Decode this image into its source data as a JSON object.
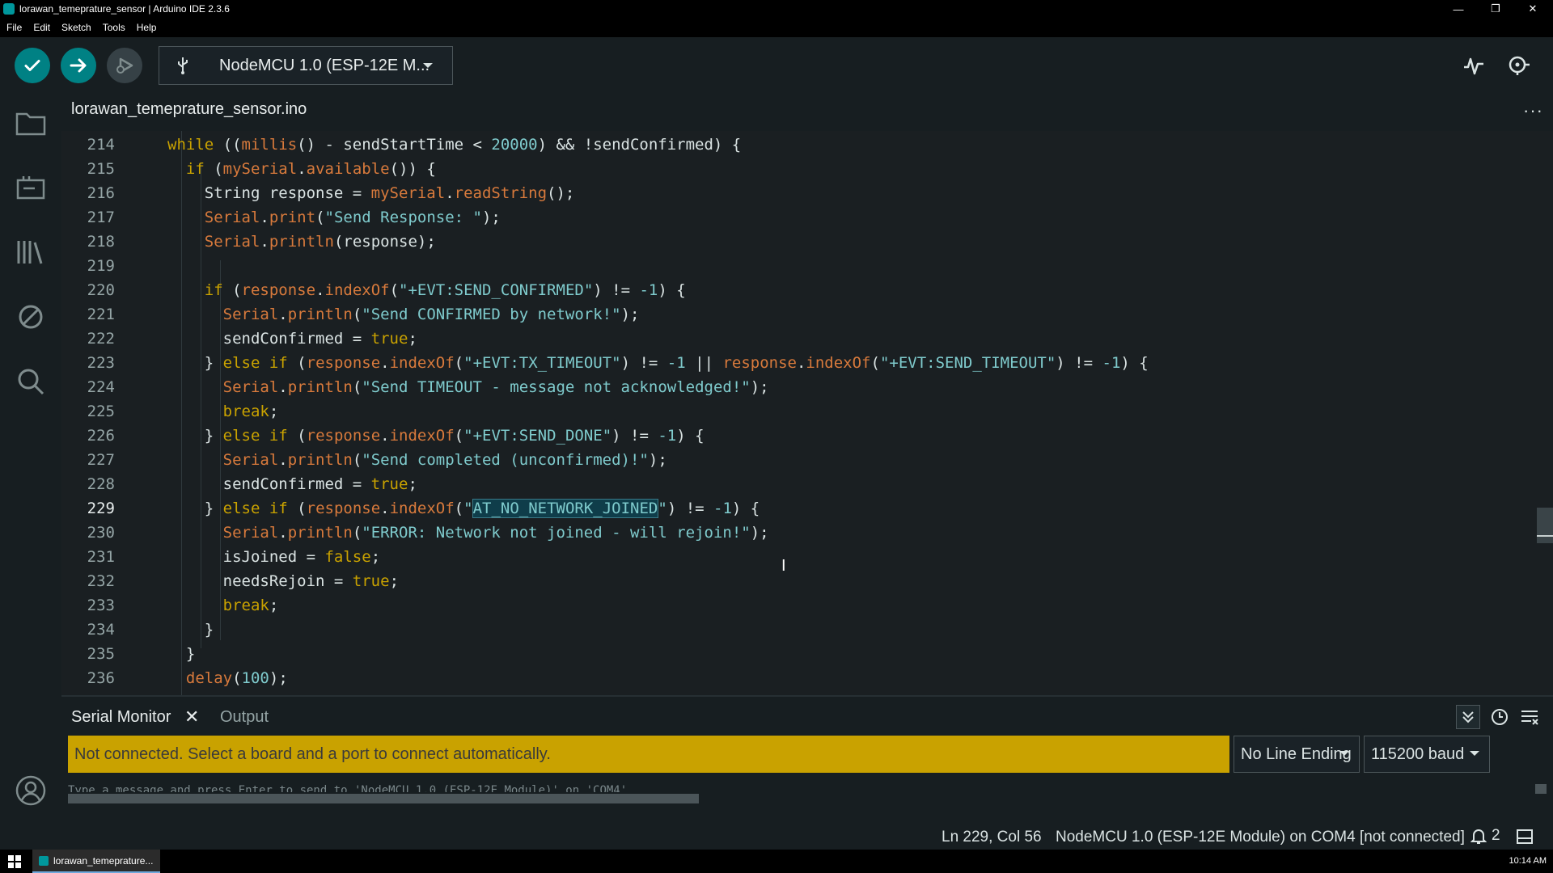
{
  "window": {
    "title": "lorawan_temeprature_sensor | Arduino IDE 2.3.6",
    "min_glyph": "—",
    "max_glyph": "❐",
    "close_glyph": "✕"
  },
  "menu": [
    "File",
    "Edit",
    "Sketch",
    "Tools",
    "Help"
  ],
  "toolbar": {
    "board_label": "NodeMCU 1.0 (ESP-12E M...",
    "icons": [
      "verify-icon",
      "upload-icon",
      "debug-icon",
      "usb-icon",
      "serial-plotter-icon",
      "serial-monitor-icon"
    ]
  },
  "sidebar": {
    "icons": [
      "folder-icon",
      "boards-manager-icon",
      "library-manager-icon",
      "debug-off-icon",
      "search-icon",
      "account-icon"
    ]
  },
  "editor": {
    "tab_label": "lorawan_temeprature_sensor.ino",
    "more_label": "···",
    "active_line": 229,
    "colors": {
      "keyword": "#c9a200",
      "function": "#d87a3c",
      "string": "#7fcbcd",
      "text": "#dae3e3"
    }
  },
  "code_lines": [
    {
      "n": "214",
      "indent": 1,
      "tokens": [
        [
          "kw",
          "while"
        ],
        [
          "t",
          " (("
        ],
        [
          "fn",
          "millis"
        ],
        [
          "t",
          "() - sendStartTime < "
        ],
        [
          "num",
          "20000"
        ],
        [
          "t",
          ") && !sendConfirmed) {"
        ]
      ]
    },
    {
      "n": "215",
      "indent": 2,
      "tokens": [
        [
          "kw",
          "if"
        ],
        [
          "t",
          " ("
        ],
        [
          "fn",
          "mySerial"
        ],
        [
          "t",
          "."
        ],
        [
          "fn",
          "available"
        ],
        [
          "t",
          "()) {"
        ]
      ]
    },
    {
      "n": "216",
      "indent": 3,
      "tokens": [
        [
          "t",
          "String response = "
        ],
        [
          "fn",
          "mySerial"
        ],
        [
          "t",
          "."
        ],
        [
          "fn",
          "readString"
        ],
        [
          "t",
          "();"
        ]
      ]
    },
    {
      "n": "217",
      "indent": 3,
      "tokens": [
        [
          "fn",
          "Serial"
        ],
        [
          "t",
          "."
        ],
        [
          "fn",
          "print"
        ],
        [
          "t",
          "("
        ],
        [
          "str",
          "\"Send Response: \""
        ],
        [
          "t",
          ");"
        ]
      ]
    },
    {
      "n": "218",
      "indent": 3,
      "tokens": [
        [
          "fn",
          "Serial"
        ],
        [
          "t",
          "."
        ],
        [
          "fn",
          "println"
        ],
        [
          "t",
          "(response);"
        ]
      ]
    },
    {
      "n": "219",
      "indent": 0,
      "tokens": []
    },
    {
      "n": "220",
      "indent": 3,
      "tokens": [
        [
          "kw",
          "if"
        ],
        [
          "t",
          " ("
        ],
        [
          "fn",
          "response"
        ],
        [
          "t",
          "."
        ],
        [
          "fn",
          "indexOf"
        ],
        [
          "t",
          "("
        ],
        [
          "str",
          "\"+EVT:SEND_CONFIRMED\""
        ],
        [
          "t",
          ") != "
        ],
        [
          "num",
          "-1"
        ],
        [
          "t",
          ") {"
        ]
      ]
    },
    {
      "n": "221",
      "indent": 4,
      "tokens": [
        [
          "fn",
          "Serial"
        ],
        [
          "t",
          "."
        ],
        [
          "fn",
          "println"
        ],
        [
          "t",
          "("
        ],
        [
          "str",
          "\"Send CONFIRMED by network!\""
        ],
        [
          "t",
          ");"
        ]
      ]
    },
    {
      "n": "222",
      "indent": 4,
      "tokens": [
        [
          "t",
          "sendConfirmed = "
        ],
        [
          "kw",
          "true"
        ],
        [
          "t",
          ";"
        ]
      ]
    },
    {
      "n": "223",
      "indent": 3,
      "tokens": [
        [
          "t",
          "} "
        ],
        [
          "kw",
          "else if"
        ],
        [
          "t",
          " ("
        ],
        [
          "fn",
          "response"
        ],
        [
          "t",
          "."
        ],
        [
          "fn",
          "indexOf"
        ],
        [
          "t",
          "("
        ],
        [
          "str",
          "\"+EVT:TX_TIMEOUT\""
        ],
        [
          "t",
          ") != "
        ],
        [
          "num",
          "-1"
        ],
        [
          "t",
          " || "
        ],
        [
          "fn",
          "response"
        ],
        [
          "t",
          "."
        ],
        [
          "fn",
          "indexOf"
        ],
        [
          "t",
          "("
        ],
        [
          "str",
          "\"+EVT:SEND_TIMEOUT\""
        ],
        [
          "t",
          ") != "
        ],
        [
          "num",
          "-1"
        ],
        [
          "t",
          ") {"
        ]
      ]
    },
    {
      "n": "224",
      "indent": 4,
      "tokens": [
        [
          "fn",
          "Serial"
        ],
        [
          "t",
          "."
        ],
        [
          "fn",
          "println"
        ],
        [
          "t",
          "("
        ],
        [
          "str",
          "\"Send TIMEOUT - message not acknowledged!\""
        ],
        [
          "t",
          ");"
        ]
      ]
    },
    {
      "n": "225",
      "indent": 4,
      "tokens": [
        [
          "kw",
          "break"
        ],
        [
          "t",
          ";"
        ]
      ]
    },
    {
      "n": "226",
      "indent": 3,
      "tokens": [
        [
          "t",
          "} "
        ],
        [
          "kw",
          "else if"
        ],
        [
          "t",
          " ("
        ],
        [
          "fn",
          "response"
        ],
        [
          "t",
          "."
        ],
        [
          "fn",
          "indexOf"
        ],
        [
          "t",
          "("
        ],
        [
          "str",
          "\"+EVT:SEND_DONE\""
        ],
        [
          "t",
          ") != "
        ],
        [
          "num",
          "-1"
        ],
        [
          "t",
          ") {"
        ]
      ]
    },
    {
      "n": "227",
      "indent": 4,
      "tokens": [
        [
          "fn",
          "Serial"
        ],
        [
          "t",
          "."
        ],
        [
          "fn",
          "println"
        ],
        [
          "t",
          "("
        ],
        [
          "str",
          "\"Send completed (unconfirmed)!\""
        ],
        [
          "t",
          ");"
        ]
      ]
    },
    {
      "n": "228",
      "indent": 4,
      "tokens": [
        [
          "t",
          "sendConfirmed = "
        ],
        [
          "kw",
          "true"
        ],
        [
          "t",
          ";"
        ]
      ]
    },
    {
      "n": "229",
      "indent": 3,
      "tokens": [
        [
          "t",
          "} "
        ],
        [
          "kw",
          "else if"
        ],
        [
          "t",
          " ("
        ],
        [
          "fn",
          "response"
        ],
        [
          "t",
          "."
        ],
        [
          "fn",
          "indexOf"
        ],
        [
          "t",
          "("
        ],
        [
          "str",
          "\""
        ],
        [
          "hl",
          "AT_NO_NETWORK_JOINED"
        ],
        [
          "str",
          "\""
        ],
        [
          "t",
          ") != "
        ],
        [
          "num",
          "-1"
        ],
        [
          "t",
          ") {"
        ]
      ]
    },
    {
      "n": "230",
      "indent": 4,
      "tokens": [
        [
          "fn",
          "Serial"
        ],
        [
          "t",
          "."
        ],
        [
          "fn",
          "println"
        ],
        [
          "t",
          "("
        ],
        [
          "str",
          "\"ERROR: Network not joined - will rejoin!\""
        ],
        [
          "t",
          ");"
        ]
      ]
    },
    {
      "n": "231",
      "indent": 4,
      "tokens": [
        [
          "t",
          "isJoined = "
        ],
        [
          "kw",
          "false"
        ],
        [
          "t",
          ";"
        ]
      ]
    },
    {
      "n": "232",
      "indent": 4,
      "tokens": [
        [
          "t",
          "needsRejoin = "
        ],
        [
          "kw",
          "true"
        ],
        [
          "t",
          ";"
        ]
      ]
    },
    {
      "n": "233",
      "indent": 4,
      "tokens": [
        [
          "kw",
          "break"
        ],
        [
          "t",
          ";"
        ]
      ]
    },
    {
      "n": "234",
      "indent": 3,
      "tokens": [
        [
          "t",
          "}"
        ]
      ]
    },
    {
      "n": "235",
      "indent": 2,
      "tokens": [
        [
          "t",
          "}"
        ]
      ]
    },
    {
      "n": "236",
      "indent": 2,
      "tokens": [
        [
          "fn",
          "delay"
        ],
        [
          "t",
          "("
        ],
        [
          "num",
          "100"
        ],
        [
          "t",
          ");"
        ]
      ]
    }
  ],
  "panel": {
    "serial_tab": "Serial Monitor",
    "close_glyph": "✕",
    "output_tab": "Output",
    "banner_text": "Not connected. Select a board and a port to connect automatically.",
    "banner_color": "#c9a200",
    "line_ending": "No Line Ending",
    "baud": "115200 baud",
    "monitor_text": "Type a message and press Enter to send to 'NodeMCU 1.0 (ESP-12E Module)' on 'COM4'",
    "icons": [
      "autoscroll-icon",
      "timestamp-icon",
      "clear-output-icon"
    ]
  },
  "statusbar": {
    "position": "Ln 229, Col 56",
    "board": "NodeMCU 1.0 (ESP-12E Module) on COM4 [not connected]",
    "notifications": "2"
  },
  "taskbar": {
    "item_label": "lorawan_temeprature...",
    "clock": "10:14 AM"
  }
}
